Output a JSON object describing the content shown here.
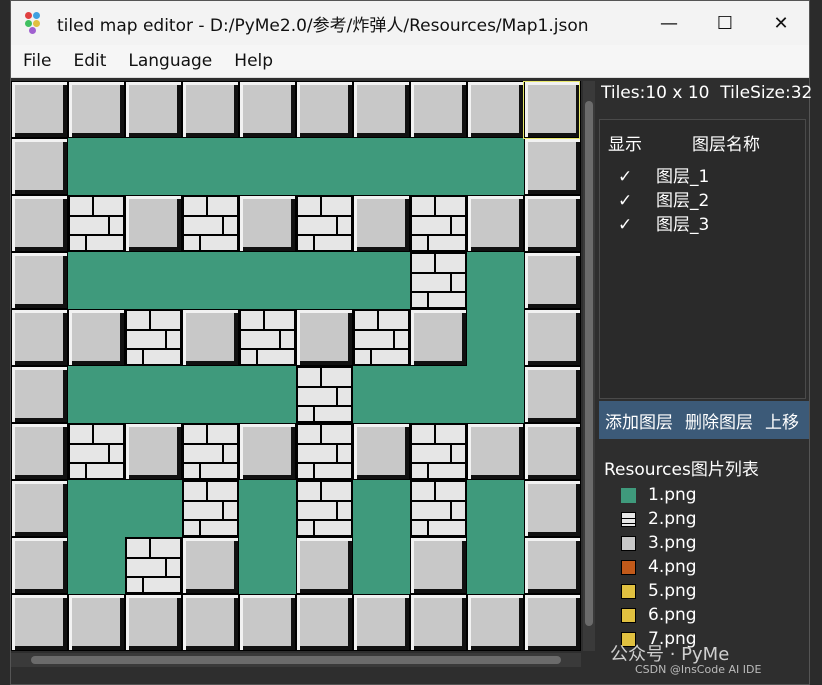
{
  "window": {
    "title": "tiled map editor - D:/PyMe2.0/参考/炸弹人/Resources/Map1.json",
    "minimize_glyph": "—",
    "maximize_glyph": "☐",
    "close_glyph": "✕"
  },
  "menu": [
    "File",
    "Edit",
    "Language",
    "Help"
  ],
  "map": {
    "legend": {
      "F": "floor",
      "S": "stone",
      "B": "brick"
    },
    "rows": [
      "SSSSSSSSSS",
      "SFFFFFFFFS",
      "SBSBSBSBSS",
      "SFFFFFFBFS",
      "SSBSBSBSFS",
      "SFFFFBFFFS",
      "SBSBSBSBSS",
      "SFFBFBFBFS",
      "SFBSFSFSFS",
      "SSSSSSSSSS"
    ]
  },
  "info": {
    "tiles": "Tiles:10 x 10",
    "tile_size": "TileSize:32"
  },
  "layers": {
    "header_show": "显示",
    "header_name": "图层名称",
    "items": [
      {
        "check": "✓",
        "name": "图层_1"
      },
      {
        "check": "✓",
        "name": "图层_2"
      },
      {
        "check": "✓",
        "name": "图层_3"
      }
    ],
    "toolbar": {
      "add": "添加图层",
      "delete": "删除图层",
      "up": "上移"
    }
  },
  "resources": {
    "title": "Resources图片列表",
    "items": [
      {
        "name": "1.png",
        "icon": "floor"
      },
      {
        "name": "2.png",
        "icon": "brick"
      },
      {
        "name": "3.png",
        "icon": "stone"
      },
      {
        "name": "4.png",
        "icon": "bomb"
      },
      {
        "name": "5.png",
        "icon": "gold"
      },
      {
        "name": "6.png",
        "icon": "gold"
      },
      {
        "name": "7.png",
        "icon": "gold"
      }
    ]
  },
  "watermark": {
    "main": "公众号 · PyMe",
    "sub": "CSDN @InsCode AI IDE"
  }
}
